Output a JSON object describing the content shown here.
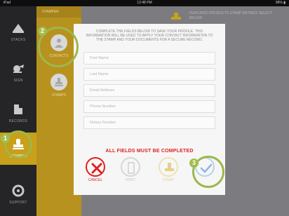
{
  "status_bar": {
    "carrier": "iPad",
    "time": "12:48 PM",
    "battery": "98% ▮"
  },
  "sidebar": {
    "items": [
      {
        "label": "STACKS",
        "icon": "stack-icon"
      },
      {
        "label": "SIGN",
        "icon": "sign-icon"
      },
      {
        "label": "RECORDS",
        "icon": "records-icon"
      },
      {
        "label": "STAMPER",
        "icon": "stamper-icon",
        "active": true
      },
      {
        "label": "SUPPORT",
        "icon": "support-icon"
      }
    ]
  },
  "panel": {
    "header": "STAMPER",
    "items": [
      {
        "label": "CONTACTS",
        "icon": "person-icon"
      },
      {
        "label": "STAMPS",
        "icon": "stamp-icon"
      }
    ]
  },
  "content": {
    "label": "FEATURED PRODUCTS STAMP ENTRIES SELECT BELOW"
  },
  "modal": {
    "intro": "COMPLETE THE FIELDS BELOW TO SAVE YOUR PROFILE. THIS INFORMATION WILL BE USED TO APPLY YOUR CONTACT INFORMATION TO THE STAMP AND YOUR DOCUMENTS FOR A SECURE RECORD.",
    "fields": [
      {
        "placeholder": "First Name"
      },
      {
        "placeholder": "Last Name"
      },
      {
        "placeholder": "Email Address"
      },
      {
        "placeholder": "Phone Number"
      },
      {
        "placeholder": "Notary Number"
      }
    ],
    "error": "ALL FIELDS MUST BE COMPLETED",
    "actions": {
      "cancel": "CANCEL",
      "print": "PRINT",
      "stamp": "STAMP",
      "confirm": ""
    }
  },
  "callouts": [
    "1",
    "2",
    "3"
  ],
  "colors": {
    "accent": "#c8a01a",
    "error": "#e02020",
    "callout": "#a2bd4d",
    "confirm": "#8db8e0"
  }
}
